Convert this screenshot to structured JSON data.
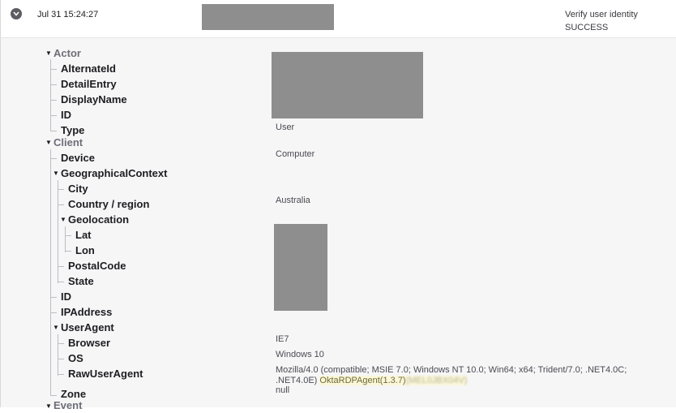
{
  "event_row": {
    "timestamp": "Jul 31 15:24:27",
    "action": "Verify user identity",
    "outcome": "SUCCESS"
  },
  "tree": {
    "actor": "Actor",
    "alternate_id": "AlternateId",
    "detail_entry": "DetailEntry",
    "display_name": "DisplayName",
    "actor_id": "ID",
    "type": "Type",
    "client": "Client",
    "device": "Device",
    "geo_context": "GeographicalContext",
    "city": "City",
    "country": "Country / region",
    "geolocation": "Geolocation",
    "lat": "Lat",
    "lon": "Lon",
    "postal_code": "PostalCode",
    "state": "State",
    "client_id": "ID",
    "ip_address": "IPAddress",
    "user_agent": "UserAgent",
    "browser": "Browser",
    "os": "OS",
    "raw_user_agent": "RawUserAgent",
    "zone": "Zone",
    "event": "Event"
  },
  "values": {
    "actor_type": "User",
    "device": "Computer",
    "country": "Australia",
    "browser": "IE7",
    "os": "Windows 10",
    "raw_user_agent": "Mozilla/4.0 (compatible; MSIE 7.0; Windows NT 10.0; Win64; x64; Trident/7.0; .NET4.0C; .NET4.0E)",
    "raw_user_agent_agent": "OktaRDPAgent(1.3.7)",
    "raw_user_agent_blurred": "(MEL0JBX04V)",
    "zone": "null"
  },
  "icons": {
    "expand": "chevron-down-icon"
  }
}
